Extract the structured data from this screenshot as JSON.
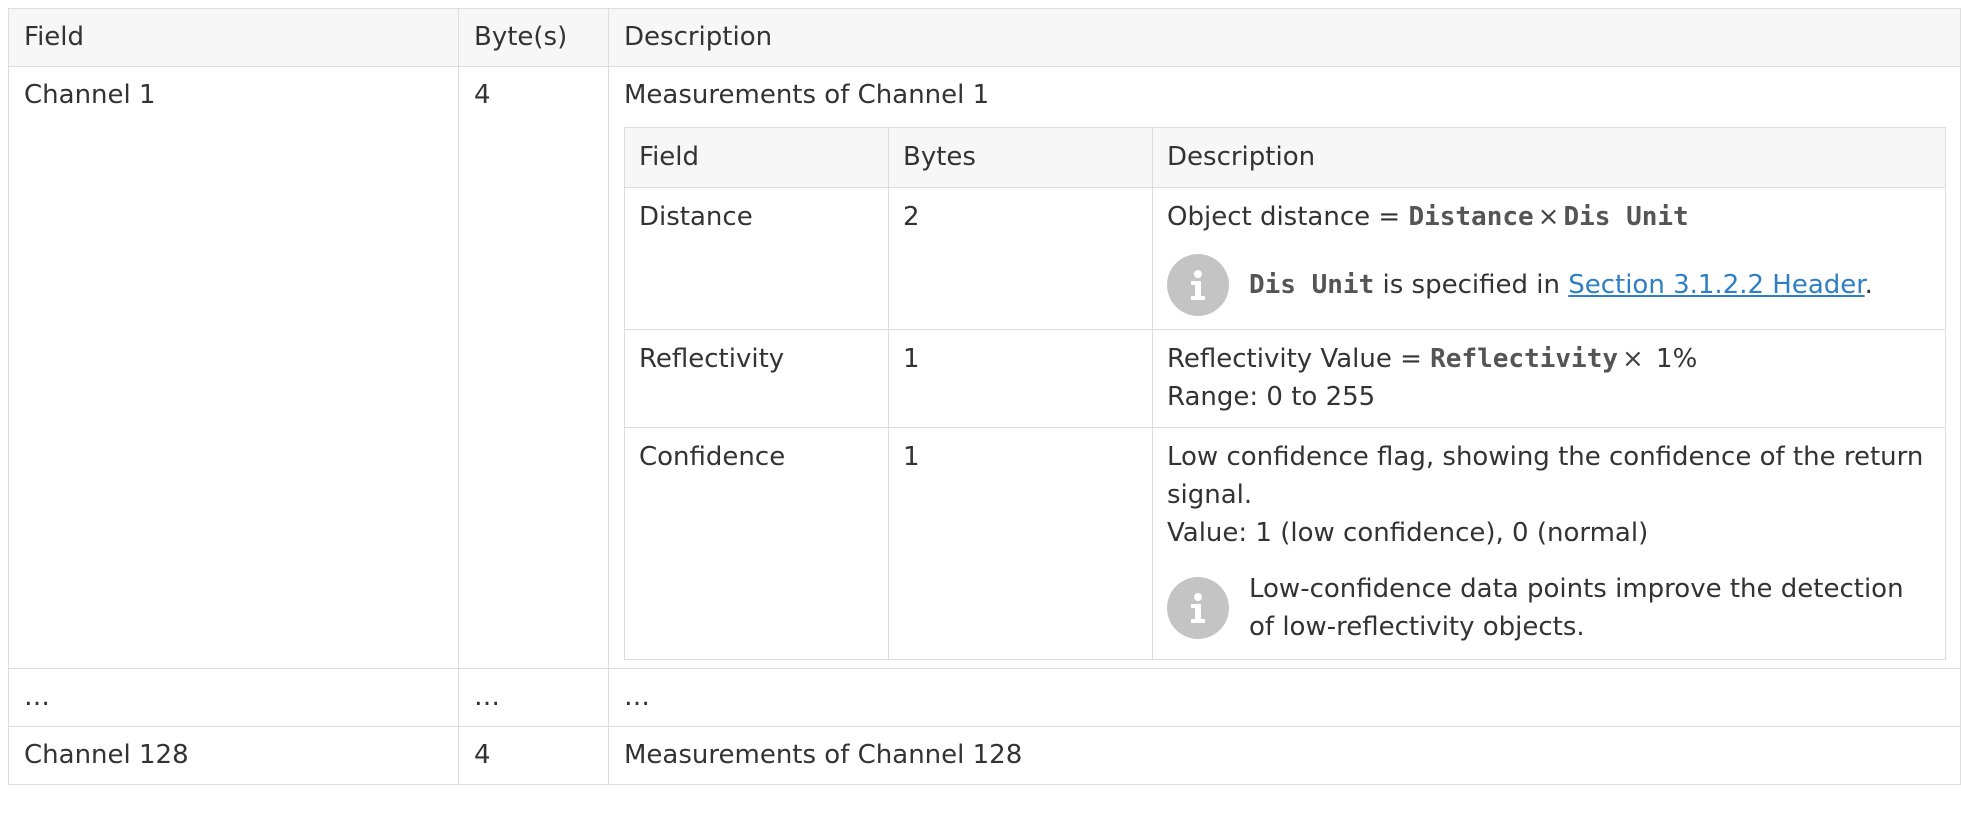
{
  "outer_table": {
    "headers": [
      "Field",
      "Byte(s)",
      "Description"
    ],
    "rows": [
      {
        "field": "Channel 1",
        "bytes": "4",
        "description": "Measurements of Channel 1"
      },
      {
        "field": "…",
        "bytes": "…",
        "description": "…"
      },
      {
        "field": "Channel 128",
        "bytes": "4",
        "description": "Measurements of Channel 128"
      }
    ]
  },
  "inner_table": {
    "headers": [
      "Field",
      "Bytes",
      "Description"
    ],
    "distance": {
      "field": "Distance",
      "bytes": "2",
      "formula_prefix": "Object distance = ",
      "formula_code1": "Distance",
      "formula_times": "×",
      "formula_code2": "Dis Unit",
      "note_code": "Dis Unit",
      "note_text": " is specified in ",
      "note_link": "Section 3.1.2.2 Header",
      "note_end": "."
    },
    "reflectivity": {
      "field": "Reflectivity",
      "bytes": "1",
      "formula_prefix": "Reflectivity Value = ",
      "formula_code": "Reflectivity",
      "formula_times": "×",
      "formula_suffix": " 1%",
      "range": "Range: 0 to 255"
    },
    "confidence": {
      "field": "Confidence",
      "bytes": "1",
      "description": "Low confidence flag, showing the confidence of the return signal.",
      "value": "Value: 1 (low confidence), 0 (normal)",
      "note": "Low-confidence data points improve the detection of low-reflectivity objects."
    }
  },
  "icons": {
    "info": "info-icon"
  },
  "colors": {
    "link": "#2f7fc4",
    "header_bg": "#f7f7f7",
    "border": "#dddddd",
    "info_badge": "#c4c4c4"
  }
}
